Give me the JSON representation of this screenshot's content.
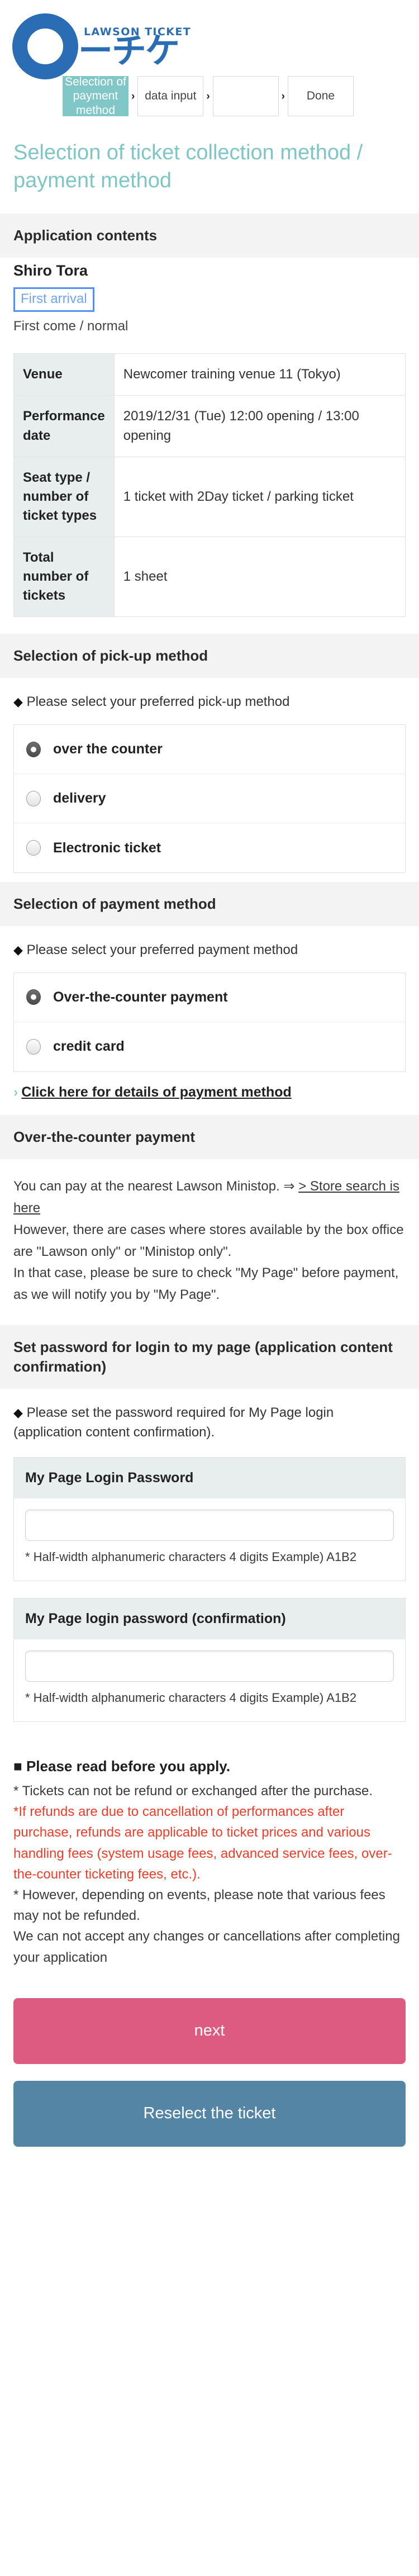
{
  "brand": {
    "logo_small_text": "LAWSON TICKET",
    "logo_main_text": "ーチケ",
    "logo_color": "#2a6db5"
  },
  "steps": {
    "separator": "›",
    "items": [
      {
        "label": "Selection of payment method",
        "active": true
      },
      {
        "label": "data input",
        "active": false
      },
      {
        "label": "",
        "active": false
      },
      {
        "label": "Done",
        "active": false
      }
    ]
  },
  "page": {
    "title": "Selection of ticket collection method / payment method",
    "title_color": "#7ec6c6"
  },
  "application_contents": {
    "section_title": "Application contents",
    "event_name": "Shiro Tora",
    "badge": "First arrival",
    "badge_sub": "First come / normal",
    "table": {
      "rows": [
        {
          "header": "Venue",
          "value": "Newcomer training venue 11 (Tokyo)"
        },
        {
          "header": "Performance date",
          "value": "2019/12/31 (Tue) 12:00 opening / 13:00 opening"
        },
        {
          "header": "Seat type / number of ticket types",
          "value": "1 ticket with 2Day ticket / parking ticket"
        },
        {
          "header": "Total number of tickets",
          "value": "1 sheet"
        }
      ]
    }
  },
  "pickup": {
    "section_title": "Selection of pick-up method",
    "prompt_marker": "◆",
    "prompt": "Please select your preferred pick-up method",
    "options": [
      {
        "label": "over the counter",
        "checked": true
      },
      {
        "label": "delivery",
        "checked": false
      },
      {
        "label": "Electronic ticket",
        "checked": false
      }
    ]
  },
  "payment": {
    "section_title": "Selection of payment method",
    "prompt_marker": "◆",
    "prompt": "Please select your preferred payment method",
    "options": [
      {
        "label": "Over-the-counter payment",
        "checked": true
      },
      {
        "label": "credit card",
        "checked": false
      }
    ],
    "details_link_chevron": "›",
    "details_link": "Click here for details of payment method"
  },
  "counter_payment": {
    "section_title": "Over-the-counter payment",
    "line1_prefix": "You can pay at the nearest Lawson Ministop. ⇒ ",
    "line1_link": "> Store search is here",
    "line2": "However, there are cases where stores available by the box office are \"Lawson only\" or \"Ministop only\".",
    "line3": "In that case, please be sure to check \"My Page\" before payment, as we will notify you by \"My Page\"."
  },
  "password": {
    "section_title": "Set password for login to my page (application content confirmation)",
    "prompt_marker": "◆",
    "prompt": "Please set the password required for My Page login (application content confirmation).",
    "fields": [
      {
        "label": "My Page Login Password",
        "value": "",
        "placeholder": "",
        "hint": "* Half-width alphanumeric characters 4 digits Example) A1B2"
      },
      {
        "label": "My Page login password (confirmation)",
        "value": "",
        "placeholder": "",
        "hint": "* Half-width alphanumeric characters 4 digits Example) A1B2"
      }
    ]
  },
  "notice": {
    "title_marker": "■",
    "title": "Please read before you apply.",
    "lines": [
      {
        "text": "* Tickets can not be refund or exchanged after the purchase.",
        "red": false
      },
      {
        "text": "*If refunds are due to cancellation of performances after purchase, refunds are applicable to ticket prices and various handling fees (system usage fees, advanced service fees, over-the-counter ticketing fees, etc.).",
        "red": true
      },
      {
        "text": "* However, depending on events, please note that various fees may not be refunded.",
        "red": false
      },
      {
        "text": "We can not accept any changes or cancellations after completing your application",
        "red": false
      }
    ]
  },
  "actions": {
    "next_label": "next",
    "next_color": "#dd5a80",
    "reselect_label": "Reselect the ticket",
    "reselect_color": "#5585a5"
  }
}
